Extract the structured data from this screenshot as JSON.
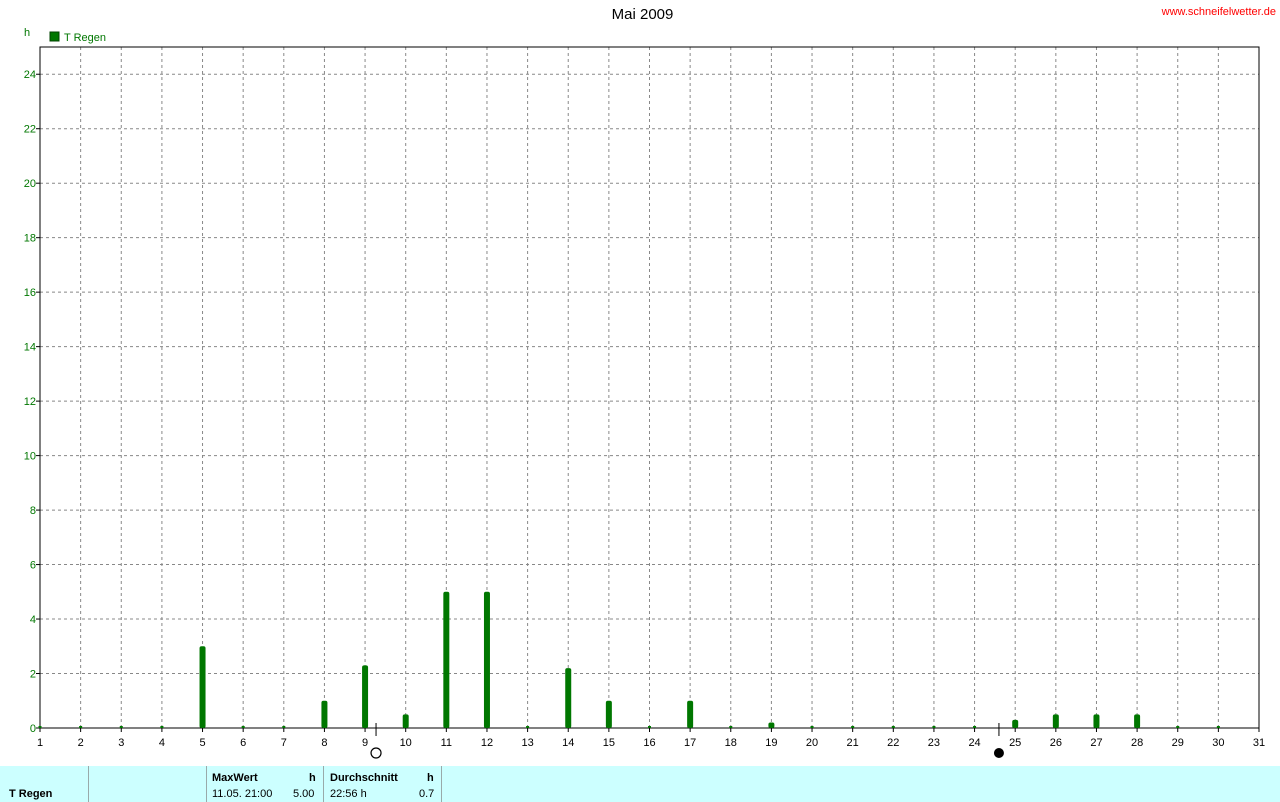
{
  "header": {
    "title": "Mai 2009",
    "site": "www.schneifelwetter.de"
  },
  "chart_data": {
    "type": "bar",
    "ylabel": "h",
    "legend": "top-left",
    "grid": true,
    "xlim": [
      1,
      31
    ],
    "ylim": [
      0,
      25
    ],
    "x_ticks": [
      1,
      2,
      3,
      4,
      5,
      6,
      7,
      8,
      9,
      10,
      11,
      12,
      13,
      14,
      15,
      16,
      17,
      18,
      19,
      20,
      21,
      22,
      23,
      24,
      25,
      26,
      27,
      28,
      29,
      30,
      31
    ],
    "y_ticks": [
      0,
      2,
      4,
      6,
      8,
      10,
      12,
      14,
      16,
      18,
      20,
      22,
      24
    ],
    "series": [
      {
        "name": "T Regen",
        "color": "#007700",
        "x": [
          1,
          2,
          3,
          4,
          5,
          6,
          7,
          8,
          9,
          10,
          11,
          12,
          13,
          14,
          15,
          16,
          17,
          18,
          19,
          20,
          21,
          22,
          23,
          24,
          25,
          26,
          27,
          28,
          29,
          30
        ],
        "values": [
          0,
          0,
          0,
          0,
          3.0,
          0,
          0,
          1.0,
          2.3,
          0.5,
          5.0,
          5.0,
          0,
          2.2,
          1.0,
          0,
          1.0,
          0,
          0.2,
          0,
          0,
          0,
          0,
          0,
          0.3,
          0.5,
          0.5,
          0.5,
          0,
          0
        ]
      }
    ],
    "moon_phases": [
      {
        "day": 9.27,
        "phase": "full-moon"
      },
      {
        "day": 24.6,
        "phase": "new-moon"
      }
    ]
  },
  "footer": {
    "series_name": "T Regen",
    "max_label": "MaxWert",
    "max_unit": "h",
    "max_time": "11.05.  21:00",
    "max_value": "5.00",
    "avg_label": "Durchschnitt",
    "avg_unit": "h",
    "avg_time": "22:56 h",
    "avg_value": "0.7"
  }
}
